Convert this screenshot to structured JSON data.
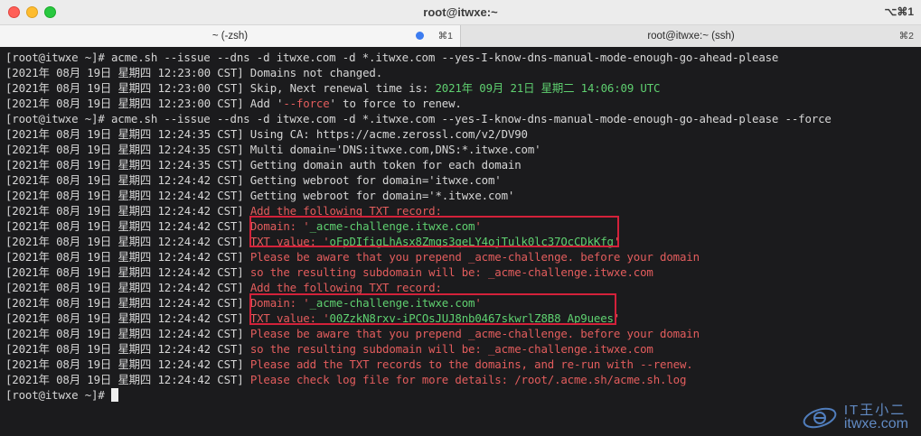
{
  "window": {
    "title": "root@itwxe:~",
    "shortcut": "⌥⌘1"
  },
  "tabs": [
    {
      "label": "~ (-zsh)",
      "key": "⌘1"
    },
    {
      "label": "root@itwxe:~ (ssh)",
      "key": "⌘2"
    }
  ],
  "terminal": {
    "lines": [
      {
        "text": "[root@itwxe ~]# acme.sh --issue --dns -d itwxe.com -d *.itwxe.com --yes-I-know-dns-manual-mode-enough-go-ahead-please"
      },
      {
        "text": "[2021年 08月 19日 星期四 12:23:00 CST] Domains not changed."
      },
      {
        "text": "[2021年 08月 19日 星期四 12:23:00 CST] Skip, Next renewal time is: ",
        "green": "2021年 09月 21日 星期二 14:06:09 UTC"
      },
      {
        "text": "[2021年 08月 19日 星期四 12:23:00 CST] Add '",
        "red": "--force",
        "tail": "' to force to renew."
      },
      {
        "text": "[root@itwxe ~]# acme.sh --issue --dns -d itwxe.com -d *.itwxe.com --yes-I-know-dns-manual-mode-enough-go-ahead-please --force"
      },
      {
        "text": "[2021年 08月 19日 星期四 12:24:35 CST] Using CA: https://acme.zerossl.com/v2/DV90"
      },
      {
        "text": "[2021年 08月 19日 星期四 12:24:35 CST] Multi domain='DNS:itwxe.com,DNS:*.itwxe.com'"
      },
      {
        "text": "[2021年 08月 19日 星期四 12:24:35 CST] Getting domain auth token for each domain"
      },
      {
        "text": "[2021年 08月 19日 星期四 12:24:42 CST] Getting webroot for domain='itwxe.com'"
      },
      {
        "text": "[2021年 08月 19日 星期四 12:24:42 CST] Getting webroot for domain='*.itwxe.com'"
      },
      {
        "text": "[2021年 08月 19日 星期四 12:24:42 CST] ",
        "red": "Add the following TXT record:"
      },
      {
        "text": "[2021年 08月 19日 星期四 12:24:42 CST] ",
        "red": "Domain: '",
        "green": "_acme-challenge.itwxe.com",
        "tailred": "'"
      },
      {
        "text": "[2021年 08月 19日 星期四 12:24:42 CST] ",
        "red": "TXT value: '",
        "green": "oFpDIfigLhAsx8Zmqs3qeLY4ojTulk0lc37QcCDkKfg",
        "tailred": "'"
      },
      {
        "text": "[2021年 08月 19日 星期四 12:24:42 CST] ",
        "red": "Please be aware that you prepend _acme-challenge. before your domain"
      },
      {
        "text": "[2021年 08月 19日 星期四 12:24:42 CST] ",
        "red": "so the resulting subdomain will be: _acme-challenge.itwxe.com"
      },
      {
        "text": "[2021年 08月 19日 星期四 12:24:42 CST] ",
        "red": "Add the following TXT record:"
      },
      {
        "text": "[2021年 08月 19日 星期四 12:24:42 CST] ",
        "red": "Domain: '",
        "green": "_acme-challenge.itwxe.com",
        "tailred": "'"
      },
      {
        "text": "[2021年 08月 19日 星期四 12:24:42 CST] ",
        "red": "TXT value: '",
        "green": "00ZzkN8rxv-iPCOsJUJ8nb0467skwrlZ8B8_Ap9uees",
        "tailred": "'"
      },
      {
        "text": "[2021年 08月 19日 星期四 12:24:42 CST] ",
        "red": "Please be aware that you prepend _acme-challenge. before your domain"
      },
      {
        "text": "[2021年 08月 19日 星期四 12:24:42 CST] ",
        "red": "so the resulting subdomain will be: _acme-challenge.itwxe.com"
      },
      {
        "text": "[2021年 08月 19日 星期四 12:24:42 CST] ",
        "red": "Please add the TXT records to the domains, and re-run with --renew."
      },
      {
        "text": "[2021年 08月 19日 星期四 12:24:42 CST] ",
        "red": "Please check log file for more details: /root/.acme.sh/acme.sh.log"
      },
      {
        "text": "[root@itwxe ~]# "
      }
    ]
  },
  "watermark": {
    "brand": "IT王小二",
    "url": "itwxe.com"
  },
  "colors": {
    "error": "#e35d5d",
    "success": "#5fd070",
    "highlight_box": "#d3213a"
  }
}
